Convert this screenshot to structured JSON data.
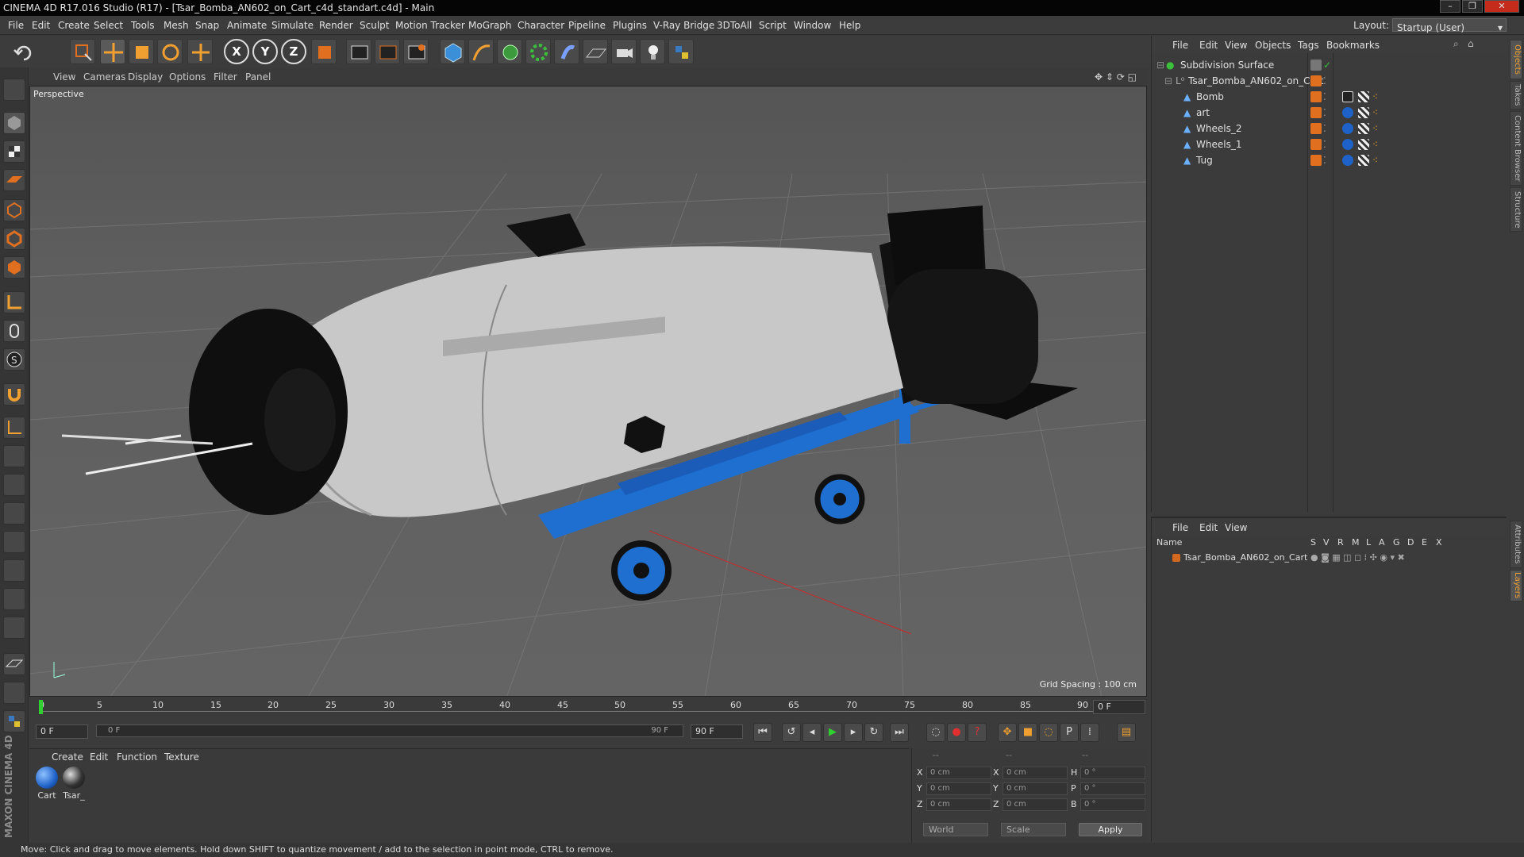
{
  "window": {
    "title": "CINEMA 4D R17.016 Studio (R17) - [Tsar_Bomba_AN602_on_Cart_c4d_standart.c4d] - Main",
    "controls": [
      "–",
      "❐",
      "✕"
    ]
  },
  "menubar": {
    "items": [
      "File",
      "Edit",
      "Create",
      "Select",
      "Tools",
      "Mesh",
      "Snap",
      "Animate",
      "Simulate",
      "Render",
      "Sculpt",
      "Motion Tracker",
      "MoGraph",
      "Character",
      "Pipeline",
      "Plugins",
      "V-Ray Bridge",
      "3DToAll",
      "Script",
      "Window",
      "Help"
    ],
    "layout_label": "Layout:",
    "layout_value": "Startup (User)"
  },
  "toolbar": {
    "axis_labels": [
      "X",
      "Y",
      "Z"
    ]
  },
  "viewport": {
    "menu": [
      "View",
      "Cameras",
      "Display",
      "Options",
      "Filter",
      "Panel"
    ],
    "camera_label": "Perspective",
    "grid_spacing": "Grid Spacing : 100 cm"
  },
  "timeline": {
    "ticks": [
      "0",
      "5",
      "10",
      "15",
      "20",
      "25",
      "30",
      "35",
      "40",
      "45",
      "50",
      "55",
      "60",
      "65",
      "70",
      "75",
      "80",
      "85",
      "90"
    ],
    "current_frame": "0 F",
    "start_frame": "0 F",
    "slider_start": "0 F",
    "slider_end": "90 F",
    "end_frame": "90 F"
  },
  "material_manager": {
    "menu": [
      "Create",
      "Edit",
      "Function",
      "Texture"
    ],
    "materials": [
      {
        "name": "Cart",
        "color": "#1e62c8"
      },
      {
        "name": "Tsar_",
        "color": "#222222"
      }
    ]
  },
  "coordinates": {
    "header_dashes": [
      "--",
      "--",
      "--"
    ],
    "rows": [
      {
        "pos_label": "X",
        "pos": "0 cm",
        "size_label": "X",
        "size": "0 cm",
        "rot_label": "H",
        "rot": "0 °"
      },
      {
        "pos_label": "Y",
        "pos": "0 cm",
        "size_label": "Y",
        "size": "0 cm",
        "rot_label": "P",
        "rot": "0 °"
      },
      {
        "pos_label": "Z",
        "pos": "0 cm",
        "size_label": "Z",
        "size": "0 cm",
        "rot_label": "B",
        "rot": "0 °"
      }
    ],
    "mode_world": "World",
    "mode_scale": "Scale",
    "apply_label": "Apply"
  },
  "object_manager": {
    "menu": [
      "File",
      "Edit",
      "View",
      "Objects",
      "Tags",
      "Bookmarks"
    ],
    "objects": [
      {
        "name": "Subdivision Surface",
        "indent": 0
      },
      {
        "name": "Tsar_Bomba_AN602_on_Cart",
        "indent": 1
      },
      {
        "name": "Bomb",
        "indent": 2
      },
      {
        "name": "art",
        "indent": 2
      },
      {
        "name": "Wheels_2",
        "indent": 2
      },
      {
        "name": "Wheels_1",
        "indent": 2
      },
      {
        "name": "Tug",
        "indent": 2
      }
    ]
  },
  "layer_manager": {
    "menu": [
      "File",
      "Edit",
      "View"
    ],
    "columns": [
      "Name",
      "S",
      "V",
      "R",
      "M",
      "L",
      "A",
      "G",
      "D",
      "E",
      "X"
    ],
    "layers": [
      {
        "name": "Tsar_Bomba_AN602_on_Cart",
        "color": "#d2691e"
      }
    ]
  },
  "side_tabs": [
    "Objects",
    "Takes",
    "Content Browser",
    "Structure",
    "Attributes",
    "Layers"
  ],
  "status": {
    "text": "Move: Click and drag to move elements. Hold down SHIFT to quantize movement / add to the selection in point mode, CTRL to remove."
  },
  "brand": {
    "text": "MAXON CINEMA 4D"
  },
  "colors": {
    "accent_orange": "#e07020",
    "cart_blue": "#1e62c8",
    "bomb_grey": "#c8c8c8"
  }
}
